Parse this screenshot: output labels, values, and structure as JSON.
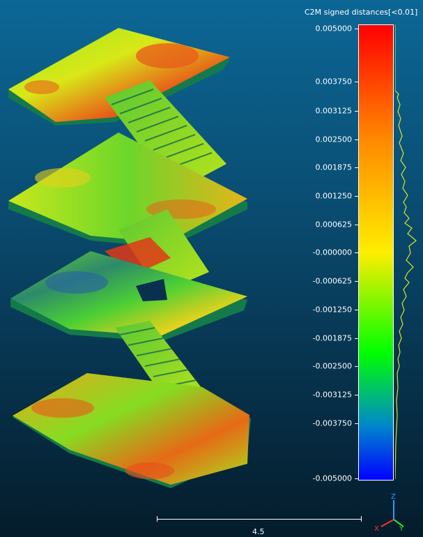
{
  "scalar_field": {
    "title": "C2M signed distances[<0.01]",
    "ticks": [
      "0.005000",
      "0.003750",
      "0.003125",
      "0.002500",
      "0.001875",
      "0.001250",
      "0.000625",
      "-0.000000",
      "-0.000625",
      "-0.001250",
      "-0.001875",
      "-0.002500",
      "-0.003125",
      "-0.003750",
      "-0.005000"
    ],
    "colors": {
      "max": "#ff0000",
      "mid": "#ffee00",
      "zero": "#00ff00",
      "min": "#0000ff"
    }
  },
  "scale_bar": {
    "label": "4.5"
  },
  "axes": {
    "x": "X",
    "y": "Y",
    "z": "Z",
    "x_color": "#ff3030",
    "y_color": "#33dd33",
    "z_color": "#3399ff"
  }
}
